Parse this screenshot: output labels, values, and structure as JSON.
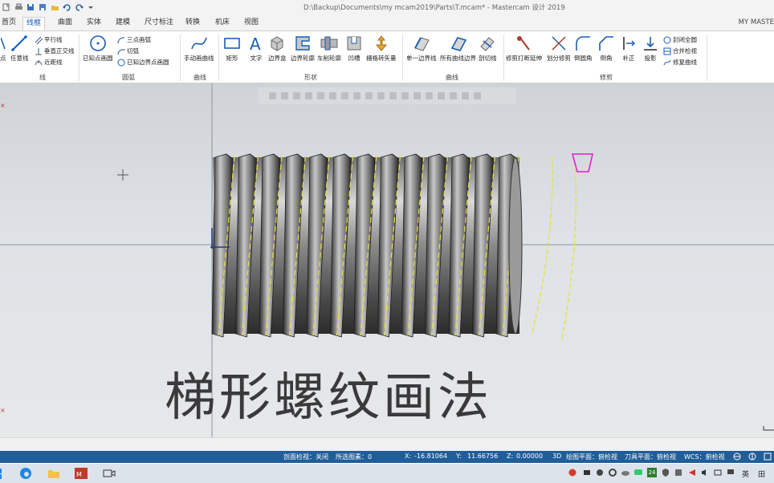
{
  "window": {
    "title": "D:\\Backup\\Documents\\my mcam2019\\Parts\\T.mcam* - Mastercam 设计 2019"
  },
  "tabs": {
    "items": [
      "首页",
      "线框",
      "曲面",
      "实体",
      "建模",
      "尺寸标注",
      "转换",
      "机床",
      "视图"
    ],
    "active": "线框",
    "user_label": "MY MASTE"
  },
  "ribbon": {
    "groups": {
      "line": "线",
      "arc": "圆弧",
      "spline": "曲线",
      "shape": "形状",
      "curve": "曲线",
      "modify": "修剪"
    },
    "line": {
      "endpoint_label": "任意线",
      "parallel_label": "平行线",
      "perpendicular_label": "垂直正交线",
      "closest_label": "近距线"
    },
    "left_edge_label": "点",
    "arc": {
      "circle_center_label": "已知点画圆",
      "three_point_label": "三点画弧",
      "tangent_label": "切弧",
      "edge_points_label": "已知边界点画圆"
    },
    "spline": {
      "manual_label": "手动画曲线"
    },
    "shape": {
      "rectangle_label": "矩形",
      "text_label": "文字",
      "bounding_box_label": "边界盒",
      "boundary_profile_label": "边界轮廓",
      "turn_profile_label": "车削轮廓",
      "relief_label": "凹槽",
      "draft_label": "栅格转矢量"
    },
    "curve": {
      "single_edge_label": "单一边界线",
      "all_edges_label": "所有曲线边界",
      "section_label": "剖切线"
    },
    "modify": {
      "trim_break_label": "修剪打断延伸",
      "divide_label": "划分修剪",
      "fillet_label": "倒圆角",
      "chamfer_label": "倒角",
      "offset_label": "补正",
      "project_label": "投影",
      "close_arc_label": "封闭全圆",
      "join_label": "合并检视",
      "repair_label": "修复曲线"
    }
  },
  "viewport": {
    "overlay_title": "梯形螺纹画法"
  },
  "status": {
    "section_view": "剖面检视：关闭",
    "selected": "所选图素：0",
    "x_label": "X:",
    "x_value": "-16.81064",
    "y_label": "Y:",
    "y_value": "11.66756",
    "z_label": "Z:",
    "z_value": "0.00000",
    "mode": "3D",
    "cplane": "绘图平面：俯检视",
    "tplane": "刀具平面：俯检视",
    "wcs": "WCS：俯检视"
  },
  "taskbar": {
    "ime": "英",
    "ime2": "田",
    "tray_num": "24"
  },
  "colors": {
    "accent": "#1a5fb4",
    "statusbar": "#1f5e9a",
    "thread_lines": "#e6e23a",
    "magenta_shape": "#e020c8"
  }
}
